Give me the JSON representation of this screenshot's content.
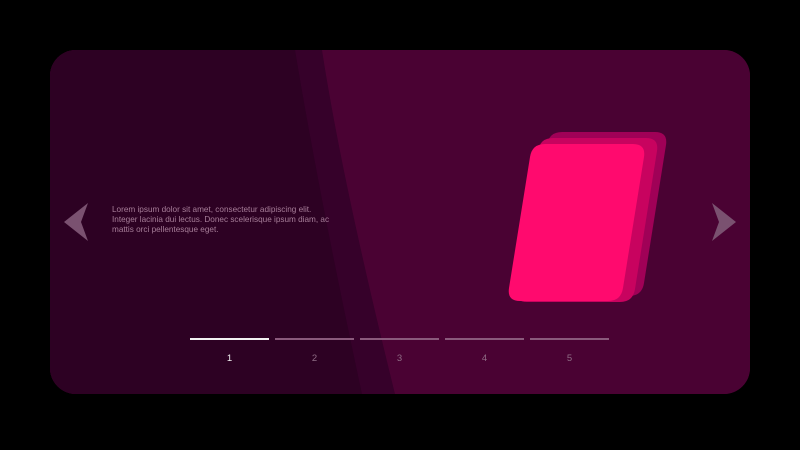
{
  "carousel": {
    "description": "Lorem ipsum dolor sit amet, consectetur adipiscing elit. Integer lacinia dui lectus. Donec scelerisque ipsum diam, ac mattis orci pellentesque eget.",
    "prev_icon": "chevron-left-icon",
    "next_icon": "chevron-right-icon",
    "active_page": 1,
    "pages": [
      {
        "label": "1"
      },
      {
        "label": "2"
      },
      {
        "label": "3"
      },
      {
        "label": "4"
      },
      {
        "label": "5"
      }
    ]
  },
  "colors": {
    "background": "#000000",
    "card": "#4a0233",
    "card_shadow": "#2b0120",
    "accent": "#ff0a6e",
    "indicator_active": "#f2f2f2",
    "indicator_inactive": "#8a5a7c"
  }
}
